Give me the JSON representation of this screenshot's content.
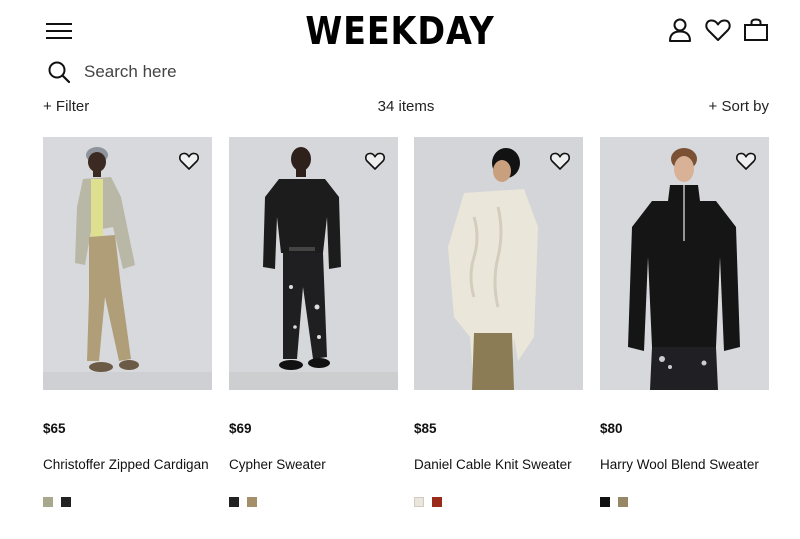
{
  "header": {
    "logo": "WEEKDAY",
    "icons": [
      "menu-icon",
      "account-icon",
      "heart-icon",
      "bag-icon"
    ]
  },
  "search": {
    "placeholder": "Search here",
    "value": ""
  },
  "toolbar": {
    "filter_label": "+ Filter",
    "items_count": "34 items",
    "sort_label": "+ Sort by"
  },
  "products": [
    {
      "price": "$65",
      "name": "Christoffer Zipped Cardigan",
      "swatches": [
        "#a8a88c",
        "#222222"
      ]
    },
    {
      "price": "$69",
      "name": "Cypher Sweater",
      "swatches": [
        "#222222",
        "#a58f6a"
      ]
    },
    {
      "price": "$85",
      "name": "Daniel Cable Knit Sweater",
      "swatches": [
        "#ebe6dc",
        "#9a2a1a"
      ]
    },
    {
      "price": "$80",
      "name": "Harry Wool Blend Sweater",
      "swatches": [
        "#111111",
        "#968766"
      ]
    }
  ],
  "colors": {
    "text": "#111111",
    "photo_bg": "#d9dadd"
  }
}
